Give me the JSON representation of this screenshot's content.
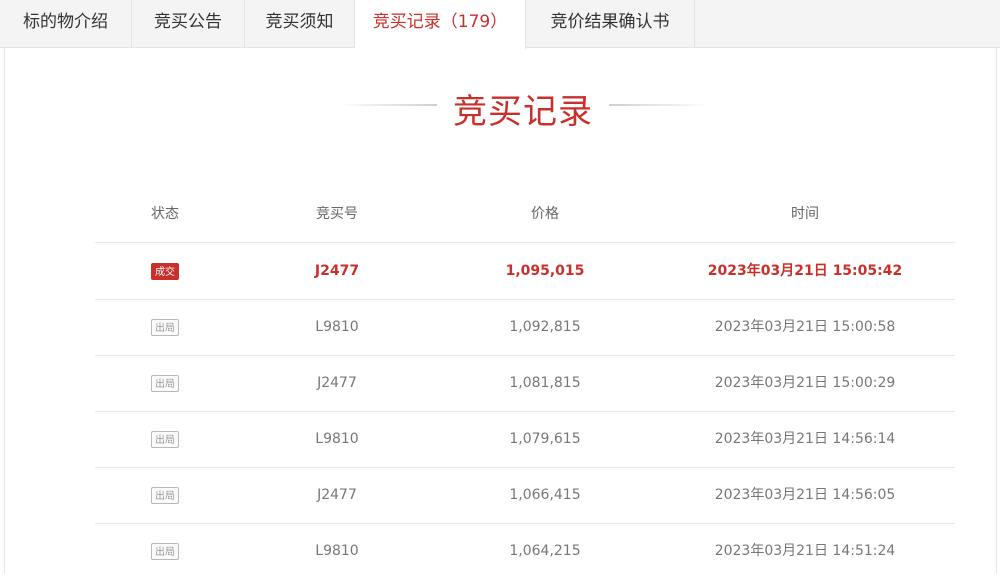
{
  "tabs": [
    {
      "label": "标的物介绍"
    },
    {
      "label": "竞买公告"
    },
    {
      "label": "竞买须知"
    },
    {
      "label": "竞买记录",
      "count": "179"
    },
    {
      "label": "竞价结果确认书"
    }
  ],
  "section_title": "竞买记录",
  "table": {
    "headers": [
      "状态",
      "竞买号",
      "价格",
      "时间"
    ],
    "rows": [
      {
        "status": "成交",
        "bidder": "J2477",
        "price": "1,095,015",
        "time": "2023年03月21日 15:05:42"
      },
      {
        "status": "出局",
        "bidder": "L9810",
        "price": "1,092,815",
        "time": "2023年03月21日 15:00:58"
      },
      {
        "status": "出局",
        "bidder": "J2477",
        "price": "1,081,815",
        "time": "2023年03月21日 15:00:29"
      },
      {
        "status": "出局",
        "bidder": "L9810",
        "price": "1,079,615",
        "time": "2023年03月21日 14:56:14"
      },
      {
        "status": "出局",
        "bidder": "J2477",
        "price": "1,066,415",
        "time": "2023年03月21日 14:56:05"
      },
      {
        "status": "出局",
        "bidder": "L9810",
        "price": "1,064,215",
        "time": "2023年03月21日 14:51:24"
      }
    ]
  },
  "colors": {
    "accent": "#c9302c",
    "tab_bar": "#f4f4f4",
    "muted_text": "#777777"
  }
}
